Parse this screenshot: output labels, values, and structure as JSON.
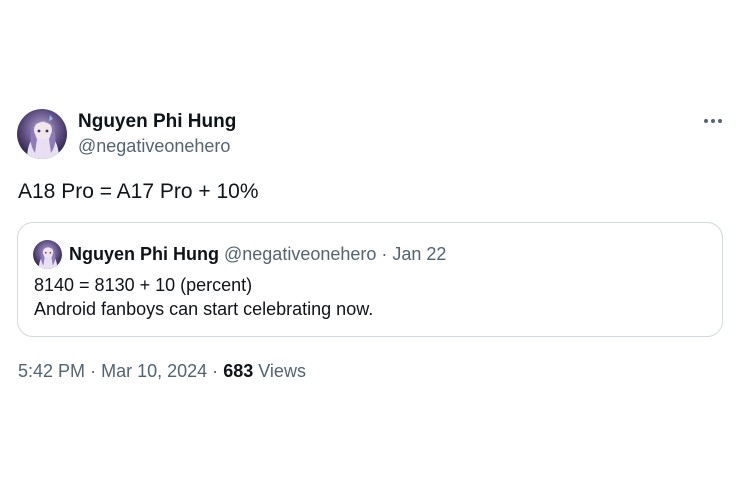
{
  "author": {
    "name": "Nguyen Phi Hung",
    "handle": "@negativeonehero"
  },
  "tweet": {
    "text": "A18 Pro = A17 Pro + 10%"
  },
  "quote": {
    "name": "Nguyen Phi Hung",
    "handle": "@negativeonehero",
    "separator": "·",
    "date": "Jan 22",
    "line1": "8140 = 8130 + 10 (percent)",
    "line2": "Android fanboys can start celebrating now."
  },
  "meta": {
    "time": "5:42 PM",
    "separator1": "·",
    "date": "Mar 10, 2024",
    "separator2": "·",
    "views_count": "683",
    "views_label": "Views"
  },
  "icons": {
    "more": "more-horizontal-icon",
    "avatar": "avatar-image"
  },
  "colors": {
    "primary_text": "#0f1419",
    "secondary_text": "#536471",
    "border": "#cfd9de"
  }
}
